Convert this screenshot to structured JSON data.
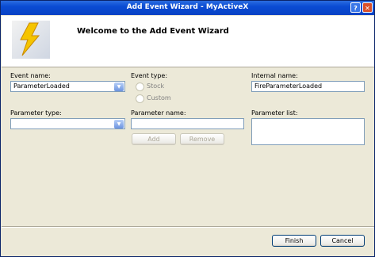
{
  "window": {
    "title": "Add Event Wizard - MyActiveX",
    "help_icon": "?",
    "close_icon": "✕"
  },
  "banner": {
    "title": "Welcome to the Add Event Wizard",
    "icon": "lightning-bolt-icon"
  },
  "event_name": {
    "label": "Event name:",
    "value": "ParameterLoaded"
  },
  "event_type": {
    "label": "Event type:",
    "stock": "Stock",
    "custom": "Custom"
  },
  "internal_name": {
    "label": "Internal name:",
    "value": "FireParameterLoaded"
  },
  "parameter_type": {
    "label": "Parameter type:",
    "value": ""
  },
  "parameter_name": {
    "label": "Parameter name:",
    "value": ""
  },
  "parameter_list": {
    "label": "Parameter list:"
  },
  "buttons": {
    "add": "Add",
    "remove": "Remove",
    "finish": "Finish",
    "cancel": "Cancel"
  },
  "colors": {
    "titlebar": "#0a4bd3",
    "bolt": "#f5c400"
  }
}
